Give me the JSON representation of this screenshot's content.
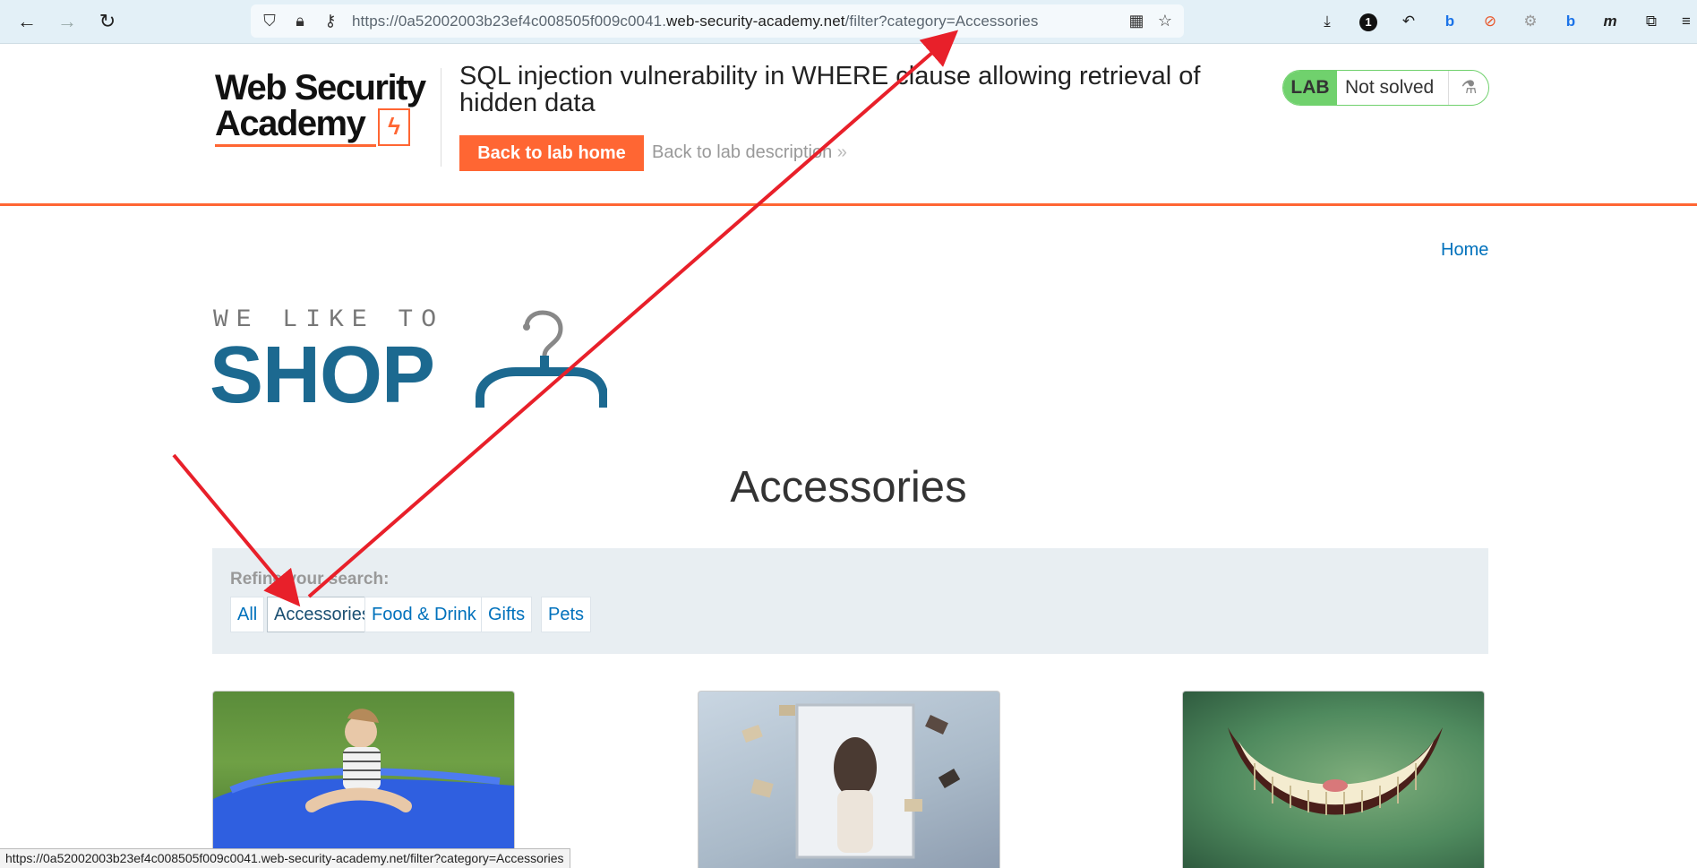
{
  "browser": {
    "url_prefix": "https://0a52002003b23ef4c008505f009c0041.",
    "url_host": "web-security-academy.net",
    "url_path": "/filter?category=Accessories",
    "status_url": "https://0a52002003b23ef4c008505f009c0041.web-security-academy.net/filter?category=Accessories",
    "notification_count": "1"
  },
  "lab": {
    "logo_line1": "Web Security",
    "logo_line2": "Academy",
    "title": "SQL injection vulnerability in WHERE clause allowing retrieval of hidden data",
    "back_home_label": "Back to lab home",
    "back_description_label": "Back to lab description",
    "badge": "LAB",
    "status": "Not solved"
  },
  "shop": {
    "home_link": "Home",
    "tagline": "WE LIKE TO",
    "brand": "SHOP",
    "category_title": "Accessories",
    "refine_label": "Refine your search:",
    "filters": [
      "All",
      "Accessories",
      "Food & Drink",
      "Gifts",
      "Pets"
    ],
    "active_filter": "Accessories"
  },
  "colors": {
    "accent": "#ff6633",
    "link": "#0071bc",
    "brand_blue": "#1c6990",
    "lab_green": "#70d16d",
    "annotation_red": "#e8202a"
  }
}
